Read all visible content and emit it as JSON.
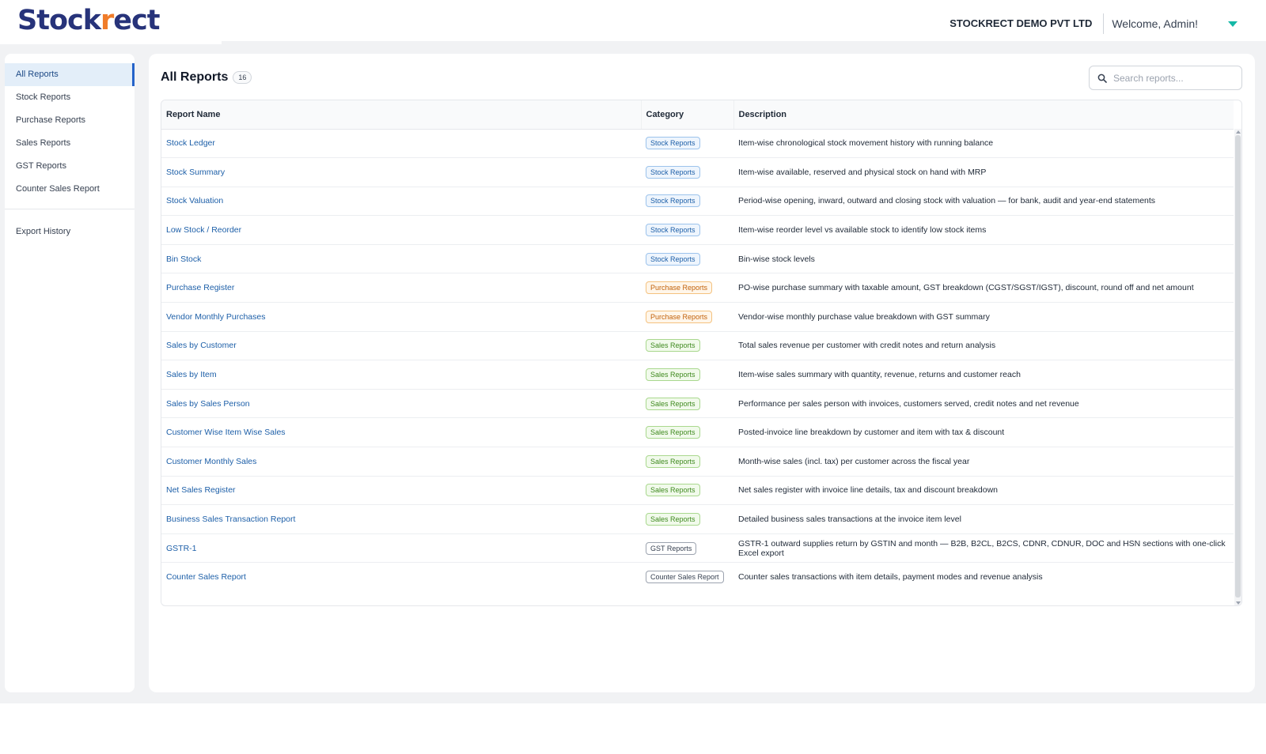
{
  "header": {
    "logo_text_a": "Stock",
    "logo_text_b": "r",
    "logo_text_c": "ect",
    "company": "STOCKRECT DEMO PVT LTD",
    "welcome": "Welcome, Admin!"
  },
  "sidebar": {
    "items": [
      {
        "label": "All Reports",
        "active": true
      },
      {
        "label": "Stock Reports"
      },
      {
        "label": "Purchase Reports"
      },
      {
        "label": "Sales Reports"
      },
      {
        "label": "GST Reports"
      },
      {
        "label": "Counter Sales Report"
      }
    ],
    "footer_item": "Export History"
  },
  "main": {
    "title": "All Reports",
    "count": "16",
    "search_placeholder": "Search reports..."
  },
  "table": {
    "columns": [
      "Report Name",
      "Category",
      "Description"
    ],
    "rows": [
      {
        "name": "Stock Ledger",
        "category": "Stock Reports",
        "description": "Item-wise chronological stock movement history with running balance"
      },
      {
        "name": "Stock Summary",
        "category": "Stock Reports",
        "description": "Item-wise available, reserved and physical stock on hand with MRP"
      },
      {
        "name": "Stock Valuation",
        "category": "Stock Reports",
        "description": "Period-wise opening, inward, outward and closing stock with valuation — for bank, audit and year-end statements"
      },
      {
        "name": "Low Stock / Reorder",
        "category": "Stock Reports",
        "description": "Item-wise reorder level vs available stock to identify low stock items"
      },
      {
        "name": "Bin Stock",
        "category": "Stock Reports",
        "description": "Bin-wise stock levels"
      },
      {
        "name": "Purchase Register",
        "category": "Purchase Reports",
        "description": "PO-wise purchase summary with taxable amount, GST breakdown (CGST/SGST/IGST), discount, round off and net amount"
      },
      {
        "name": "Vendor Monthly Purchases",
        "category": "Purchase Reports",
        "description": "Vendor-wise monthly purchase value breakdown with GST summary"
      },
      {
        "name": "Sales by Customer",
        "category": "Sales Reports",
        "description": "Total sales revenue per customer with credit notes and return analysis"
      },
      {
        "name": "Sales by Item",
        "category": "Sales Reports",
        "description": "Item-wise sales summary with quantity, revenue, returns and customer reach"
      },
      {
        "name": "Sales by Sales Person",
        "category": "Sales Reports",
        "description": "Performance per sales person with invoices, customers served, credit notes and net revenue"
      },
      {
        "name": "Customer Wise Item Wise Sales",
        "category": "Sales Reports",
        "description": "Posted-invoice line breakdown by customer and item with tax & discount"
      },
      {
        "name": "Customer Monthly Sales",
        "category": "Sales Reports",
        "description": "Month-wise sales (incl. tax) per customer across the fiscal year"
      },
      {
        "name": "Net Sales Register",
        "category": "Sales Reports",
        "description": "Net sales register with invoice line details, tax and discount breakdown"
      },
      {
        "name": "Business Sales Transaction Report",
        "category": "Sales Reports",
        "description": "Detailed business sales transactions at the invoice item level"
      },
      {
        "name": "GSTR-1",
        "category": "GST Reports",
        "description": "GSTR-1 outward supplies return by GSTIN and month — B2B, B2CL, B2CS, CDNR, CDNUR, DOC and HSN sections with one-click Excel export"
      },
      {
        "name": "Counter Sales Report",
        "category": "Counter Sales Report",
        "description": "Counter sales transactions with item details, payment modes and revenue analysis"
      }
    ]
  },
  "colors": {
    "brand": "#27337a",
    "brand_accent": "#f07c2a",
    "link": "#1d5fa8",
    "active_bg": "#e3eef9",
    "active_bar": "#2563c9",
    "caret": "#14b8a6",
    "badge_stock": {
      "fg": "#1d5fa8",
      "bg": "#eef5fd",
      "border": "#9cc3ec"
    },
    "badge_purchase": {
      "fg": "#c2620a",
      "bg": "#fff6ea",
      "border": "#f4c27f"
    },
    "badge_sales": {
      "fg": "#3f8a1f",
      "bg": "#f1faeb",
      "border": "#a9d88e"
    },
    "badge_gst": {
      "fg": "#374151",
      "bg": "#ffffff",
      "border": "#9ca3af"
    },
    "badge_counter": {
      "fg": "#374151",
      "bg": "#ffffff",
      "border": "#9ca3af"
    }
  },
  "icons": {
    "search": "search-icon",
    "user_menu": "chevron-down-icon"
  }
}
